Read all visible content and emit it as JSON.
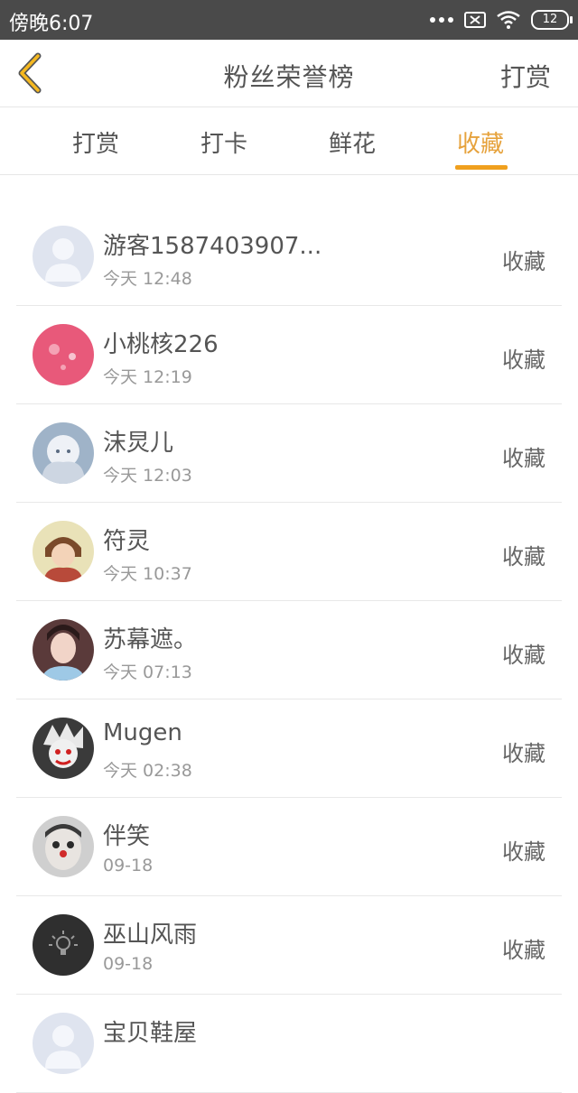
{
  "status": {
    "time": "傍晚6:07",
    "battery": "12",
    "icons": [
      "more-icon",
      "sim-off-icon",
      "wifi-icon",
      "battery-icon"
    ]
  },
  "header": {
    "back_icon": "chevron-left-icon",
    "title": "粉丝荣誉榜",
    "right_action": "打赏"
  },
  "tabs": [
    {
      "label": "打赏"
    },
    {
      "label": "打卡"
    },
    {
      "label": "鲜花"
    },
    {
      "label": "收藏"
    }
  ],
  "active_tab": "收藏",
  "colors": {
    "accent": "#f0a01e",
    "status_bar": "#4a4a4a",
    "text": "#555555",
    "muted": "#999999",
    "divider": "#e8e8e8"
  },
  "items": [
    {
      "name": "游客1587403907...",
      "time": "今天 12:48",
      "action": "收藏",
      "avatar": "default-user-avatar"
    },
    {
      "name": "小桃核226",
      "time": "今天 12:19",
      "action": "收藏",
      "avatar": "pink-avatar"
    },
    {
      "name": "沫炅儿",
      "time": "今天 12:03",
      "action": "收藏",
      "avatar": "anime-girl-avatar"
    },
    {
      "name": "符灵",
      "time": "今天 10:37",
      "action": "收藏",
      "avatar": "anime-character-avatar"
    },
    {
      "name": "苏幕遮。",
      "time": "今天 07:13",
      "action": "收藏",
      "avatar": "photo-avatar"
    },
    {
      "name": "Mugen",
      "time": "今天 02:38",
      "action": "收藏",
      "avatar": "cartoon-avatar"
    },
    {
      "name": "伴笑",
      "time": "09-18",
      "action": "收藏",
      "avatar": "clown-avatar"
    },
    {
      "name": "巫山风雨",
      "time": "09-18",
      "action": "收藏",
      "avatar": "lightbulb-avatar"
    },
    {
      "name": "宝贝鞋屋",
      "time": "",
      "action": "",
      "avatar": "default-user-avatar"
    }
  ]
}
